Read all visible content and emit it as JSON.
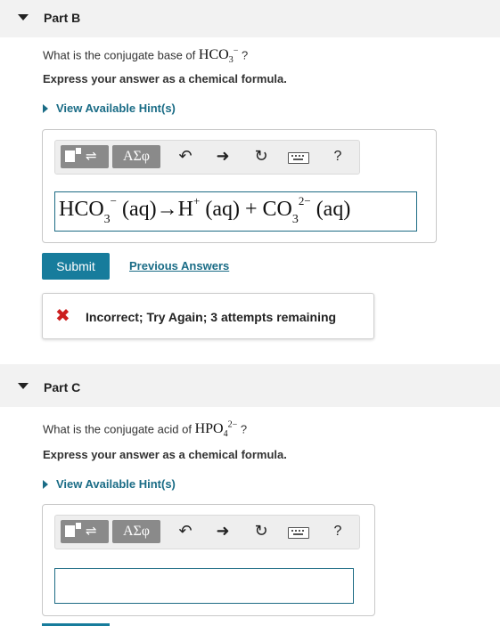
{
  "partB": {
    "title": "Part B",
    "question_prefix": "What is the conjugate base of",
    "formula_main": "HCO",
    "formula_sub": "3",
    "formula_sup": "−",
    "question_suffix": "?",
    "express": "Express your answer as a chemical formula.",
    "hint_label": "View Available Hint(s)",
    "toolbar": {
      "greek": "AΣφ",
      "undo_icon": "↶",
      "redo_icon": "➜",
      "reset_icon": "↻",
      "help": "?"
    },
    "answer": {
      "t1": "HCO",
      "t1_sub": "3",
      "t1_sup": "−",
      "t2": "(aq)→H",
      "t2_sup": "+",
      "t3": "(aq) + CO",
      "t3_sub": "3",
      "t3_sup": "2−",
      "t4": "(aq)"
    },
    "submit": "Submit",
    "previous_answers": "Previous Answers",
    "feedback_icon": "✖",
    "feedback": "Incorrect; Try Again; 3 attempts remaining"
  },
  "partC": {
    "title": "Part C",
    "question_prefix": "What is the conjugate acid of",
    "formula_main": "HPO",
    "formula_sub": "4",
    "formula_sup": "2−",
    "question_suffix": "?",
    "express": "Express your answer as a chemical formula.",
    "hint_label": "View Available Hint(s)",
    "toolbar": {
      "greek": "AΣφ",
      "undo_icon": "↶",
      "redo_icon": "➜",
      "reset_icon": "↻",
      "help": "?"
    },
    "answer_value": ""
  }
}
